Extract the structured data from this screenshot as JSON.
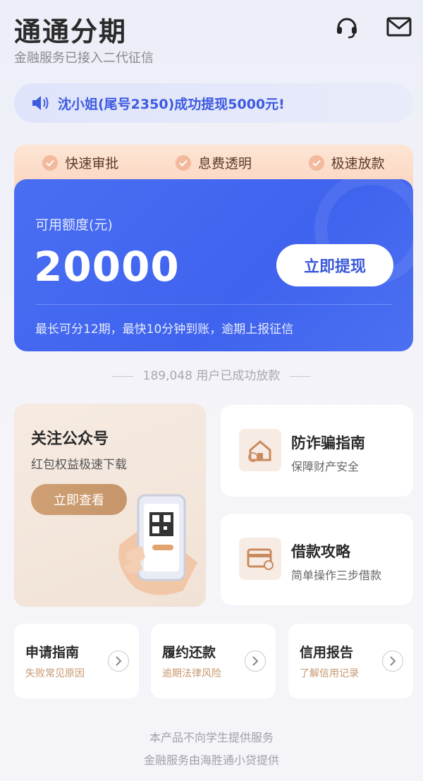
{
  "header": {
    "title": "通通分期",
    "subtitle": "金融服务已接入二代征信",
    "icons": [
      "headset-icon",
      "mail-icon"
    ]
  },
  "notice": {
    "text": "沈小姐(尾号2350)成功提现5000元!",
    "icon": "speaker-icon",
    "color": "#3d5ae0"
  },
  "features": [
    {
      "label": "快速审批"
    },
    {
      "label": "息费透明"
    },
    {
      "label": "极速放款"
    }
  ],
  "credit": {
    "label": "可用额度(元)",
    "amount": "20000",
    "button": "立即提现",
    "note": "最长可分12期，最快10分钟到账，逾期上报征信",
    "color": "#4467f0"
  },
  "users": {
    "text": "189,048 用户已成功放款"
  },
  "follow": {
    "title": "关注公众号",
    "subtitle": "红包权益极速下载",
    "button": "立即查看"
  },
  "guides": [
    {
      "title": "防诈骗指南",
      "subtitle": "保障财产安全",
      "icon": "house-shield-icon"
    },
    {
      "title": "借款攻略",
      "subtitle": "简单操作三步借款",
      "icon": "card-icon"
    }
  ],
  "mini_cards": [
    {
      "title": "申请指南",
      "subtitle": "失败常见原因"
    },
    {
      "title": "履约还款",
      "subtitle": "逾期法律风险"
    },
    {
      "title": "信用报告",
      "subtitle": "了解信用记录"
    }
  ],
  "footer": {
    "line1": "本产品不向学生提供服务",
    "line2": "金融服务由海胜通小贷提供"
  }
}
